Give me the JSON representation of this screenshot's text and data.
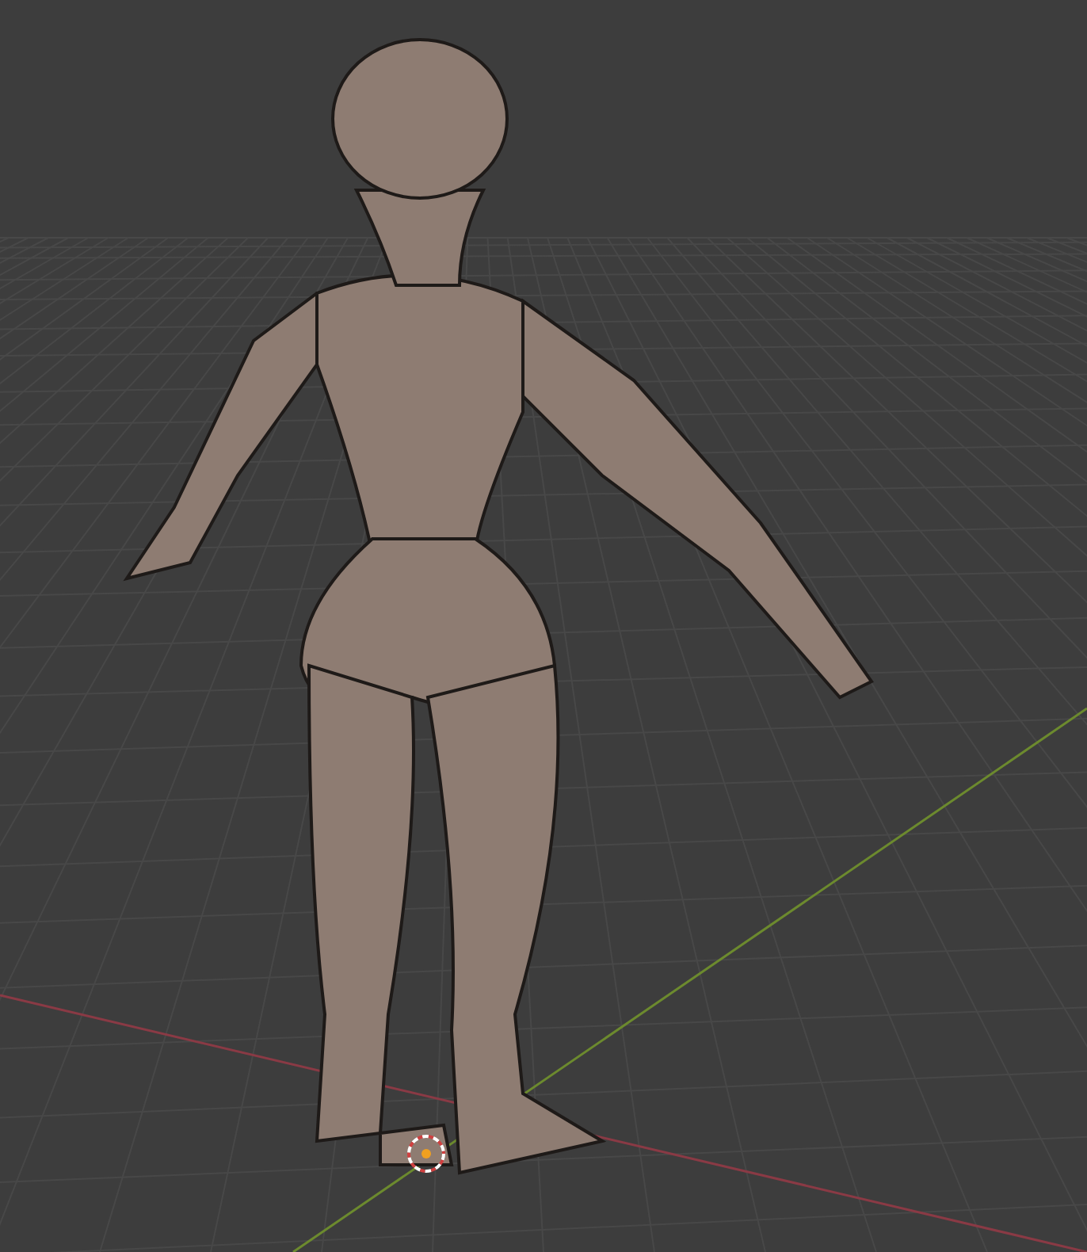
{
  "viewport": {
    "show_grid": true,
    "show_axes": true,
    "show_cursor": true,
    "show_model": true
  }
}
